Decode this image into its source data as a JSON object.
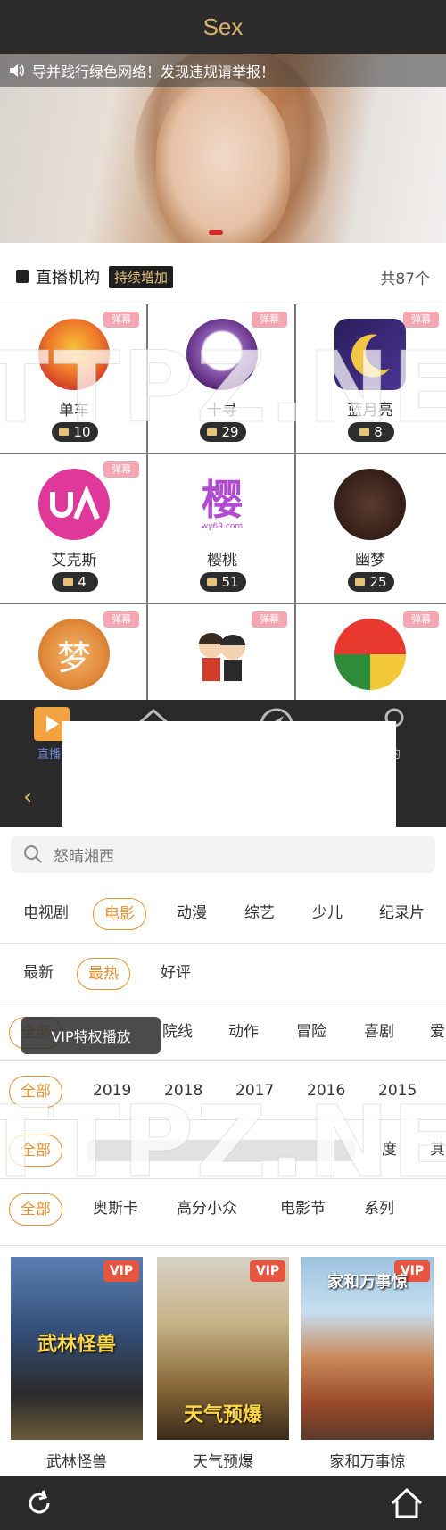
{
  "screen1": {
    "title": "Sex",
    "notice": "导并践行绿色网络！发现违规请举报！",
    "section": {
      "label": "直播机构",
      "tag": "持续增加",
      "count": "共87个"
    },
    "danmu_badge": "弹幕",
    "platforms": [
      {
        "name": "单车",
        "count": "10",
        "color": "#e8692a"
      },
      {
        "name": "十寻",
        "count": "29",
        "color": "#7a4a9e"
      },
      {
        "name": "蓝月亮",
        "count": "8",
        "color": "#3b2c7a"
      },
      {
        "name": "艾克斯",
        "count": "4",
        "color": "#e3379a"
      },
      {
        "name": "樱桃",
        "count": "51",
        "color": "#b04bd0"
      },
      {
        "name": "幽梦",
        "count": "25",
        "color": "#6a3c2a"
      },
      {
        "name": "",
        "count": "",
        "color": "#e69b4a",
        "glyph": "梦"
      },
      {
        "name": "",
        "count": "",
        "color": "#f0f0f0"
      },
      {
        "name": "",
        "count": "",
        "color": "#e8392e"
      }
    ],
    "sakura_sub": "wy69.com",
    "nav": {
      "left_label": "直播",
      "right_label": "的"
    }
  },
  "screen2": {
    "search_placeholder": "怒晴湘西",
    "toast": "VIP特权播放",
    "categories": {
      "items": [
        "电视剧",
        "电影",
        "动漫",
        "综艺",
        "少儿",
        "纪录片"
      ],
      "active": "电影"
    },
    "sort": {
      "items": [
        "最新",
        "最热",
        "好评"
      ],
      "active": "最热"
    },
    "genre": {
      "items": [
        "全部",
        "院线",
        "动作",
        "冒险",
        "喜剧",
        "爱"
      ]
    },
    "years": {
      "items": [
        "全部",
        "2019",
        "2018",
        "2017",
        "2016",
        "2015"
      ]
    },
    "region": {
      "items": [
        "全部",
        "度",
        "其"
      ]
    },
    "special": {
      "items": [
        "全部",
        "奥斯卡",
        "高分小众",
        "电影节",
        "系列"
      ]
    },
    "vip_badge": "VIP",
    "movies": [
      {
        "name": "武林怪兽",
        "poster_title": "武林怪兽"
      },
      {
        "name": "天气预爆",
        "poster_title": "天气预爆"
      },
      {
        "name": "家和万事惊",
        "poster_title": "家和万事惊"
      }
    ]
  },
  "watermark": "TTPZ.NE",
  "colors": {
    "accent_gold": "#d9b36a",
    "accent_orange": "#e8902e",
    "dark_bar": "#2b2b2b",
    "vip_red": "#e65540"
  }
}
